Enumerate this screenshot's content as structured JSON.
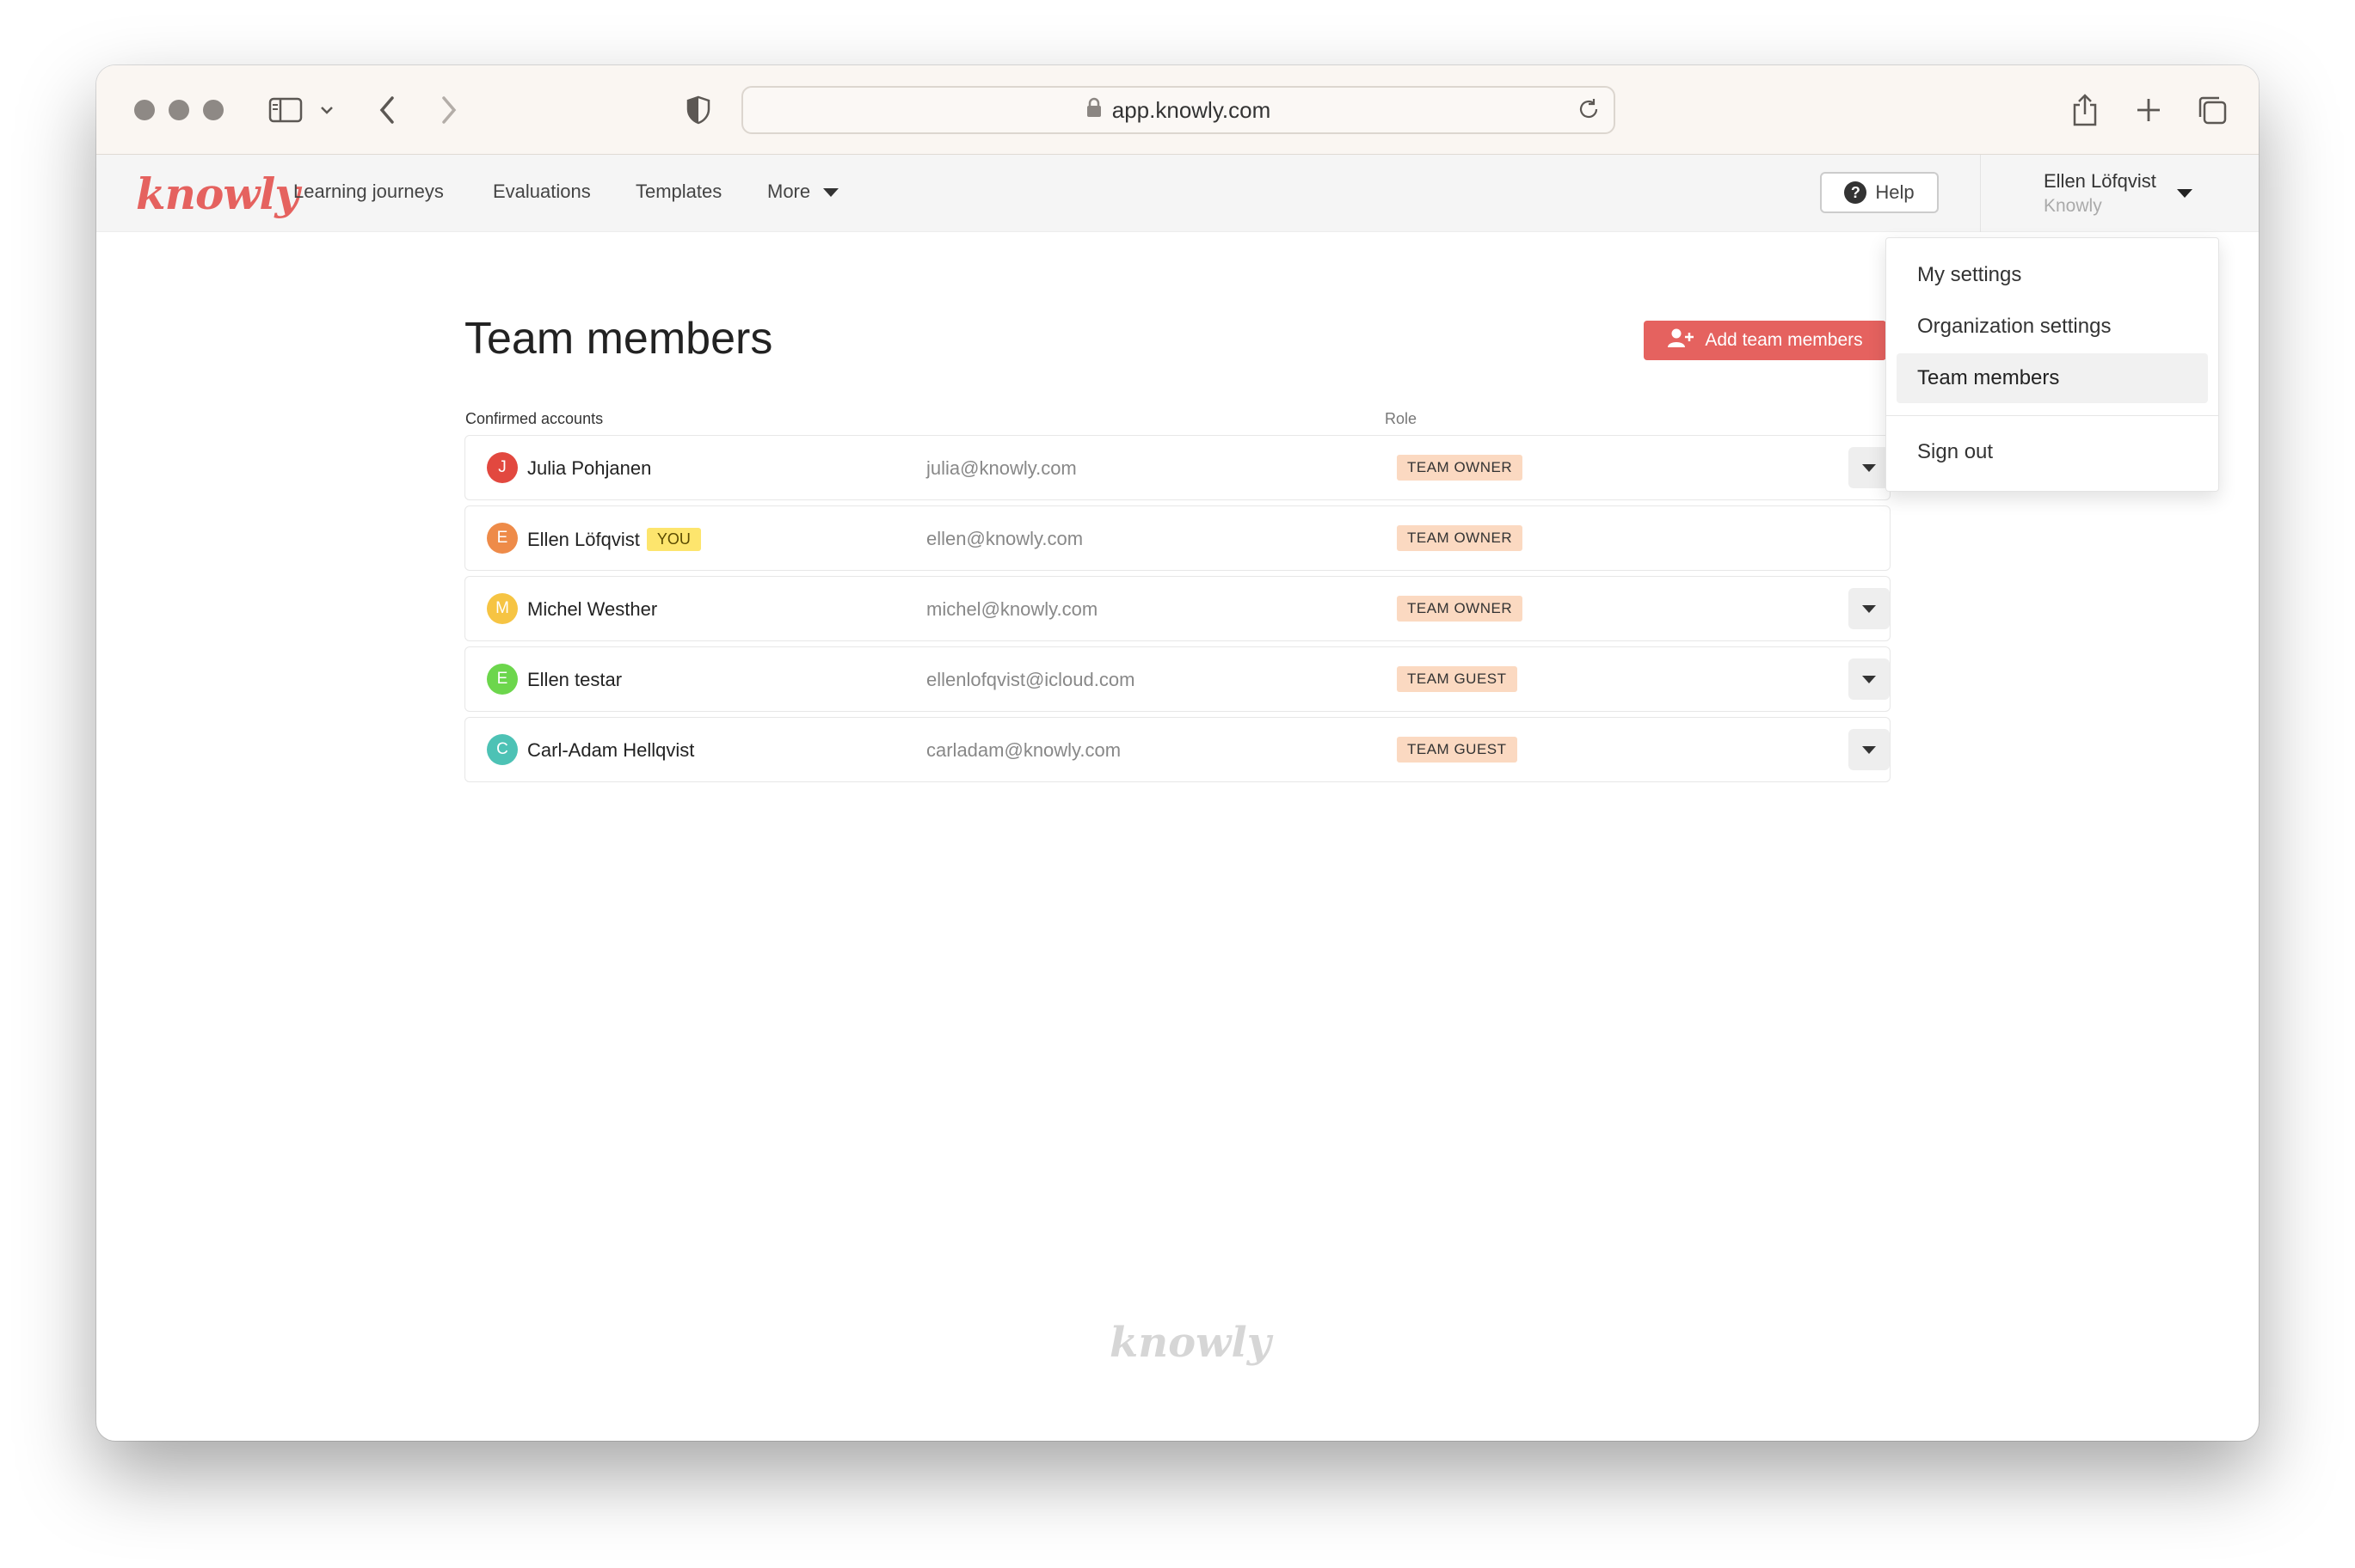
{
  "browser": {
    "url": "app.knowly.com"
  },
  "header": {
    "logo": "knowly",
    "nav": [
      "Learning journeys",
      "Evaluations",
      "Templates"
    ],
    "more_label": "More",
    "help_label": "Help",
    "user_name": "Ellen Löfqvist",
    "user_org": "Knowly"
  },
  "main": {
    "title": "Team members",
    "add_button": "Add team members",
    "section_label": "Confirmed accounts",
    "role_column": "Role",
    "you_badge": "YOU",
    "members": [
      {
        "initial": "J",
        "name": "Julia Pohjanen",
        "email": "julia@knowly.com",
        "role": "TEAM OWNER",
        "color": "#e2483f"
      },
      {
        "initial": "E",
        "name": "Ellen Löfqvist",
        "email": "ellen@knowly.com",
        "role": "TEAM OWNER",
        "color": "#ee8b49"
      },
      {
        "initial": "M",
        "name": "Michel Westher",
        "email": "michel@knowly.com",
        "role": "TEAM OWNER",
        "color": "#f6c443"
      },
      {
        "initial": "E",
        "name": "Ellen testar",
        "email": "ellenlofqvist@icloud.com",
        "role": "TEAM GUEST",
        "color": "#6cd64c"
      },
      {
        "initial": "C",
        "name": "Carl-Adam Hellqvist",
        "email": "carladam@knowly.com",
        "role": "TEAM GUEST",
        "color": "#4dc2b5"
      }
    ]
  },
  "user_menu": {
    "items": [
      "My settings",
      "Organization settings",
      "Team members"
    ],
    "sign_out": "Sign out"
  },
  "footer": {
    "logo": "knowly"
  },
  "colors": {
    "accent": "#e5625f",
    "you_badge": "#fde56d",
    "role_badge": "#fbd9c1"
  }
}
